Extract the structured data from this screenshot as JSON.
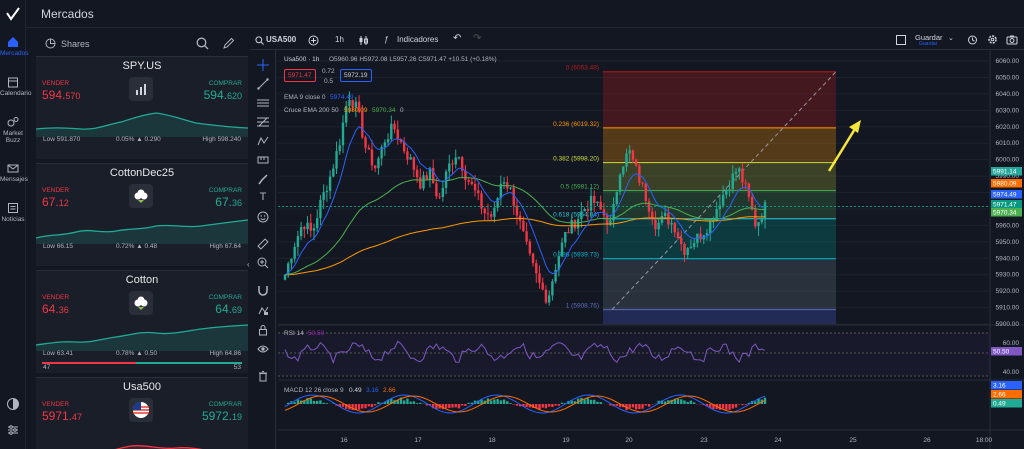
{
  "app": {
    "title": "Mercados"
  },
  "nav": [
    {
      "label": "Mercados",
      "icon": "home-icon",
      "active": true
    },
    {
      "label": "Calendario",
      "icon": "calendar-icon"
    },
    {
      "label": "Market Buzz",
      "icon": "buzz-icon"
    },
    {
      "label": "Mensajes",
      "icon": "mail-icon"
    },
    {
      "label": "Noticias",
      "icon": "news-icon"
    }
  ],
  "watchlist": {
    "title": "Shares",
    "items": [
      {
        "name": "SPY.US",
        "sell_label": "VENDER",
        "buy_label": "COMPRAR",
        "sell_main": "594.",
        "sell_small": "570",
        "buy_main": "594.",
        "buy_small": "620",
        "low": "Low 591.870",
        "change": "0.05% ▲ 0.290",
        "high": "High 598.240",
        "trend": "up",
        "logo": "chart-logo-icon"
      },
      {
        "name": "CottonDec25",
        "sell_label": "VENDER",
        "buy_label": "COMPRAR",
        "sell_main": "67.",
        "sell_small": "12",
        "buy_main": "67.",
        "buy_small": "36",
        "low": "Low 66.15",
        "change": "0.72% ▲ 0.48",
        "high": "High 67.64",
        "trend": "up",
        "logo": "cotton-icon"
      },
      {
        "name": "Cotton",
        "sell_label": "VENDER",
        "buy_label": "COMPRAR",
        "sell_main": "64.",
        "sell_small": "36",
        "buy_main": "64.",
        "buy_small": "69",
        "low": "Low 63.41",
        "change": "0.78% ▲ 0.50",
        "high": "High 64.86",
        "bar_left": "47",
        "bar_right": "53",
        "trend": "up",
        "logo": "cotton-icon"
      },
      {
        "name": "Usa500",
        "sell_label": "VENDER",
        "buy_label": "COMPRAR",
        "sell_main": "5971.",
        "sell_small": "47",
        "buy_main": "5972.",
        "buy_small": "19",
        "trend": "down",
        "logo": "us-flag-icon"
      }
    ]
  },
  "toolbar": {
    "symbol": "USA500",
    "interval": "1h",
    "indicators": "Indicadores",
    "save": "Guardar",
    "save_sub": "Guardar"
  },
  "legend": {
    "symbol": "Usa500 · 1h",
    "ohlc": "O5960.96  H5972.08  L5957.26  C5971.47  +10.51 (+0.18%)",
    "sell_box": "5971.47",
    "mid_top": "0.72",
    "mid_bot": "0.5",
    "buy_box": "5972.19",
    "ema": "EMA  9 close 0",
    "ema_val": "5974.49",
    "cross": "Cruce EMA  200 50",
    "cross_v1": "5980.09",
    "cross_v2": "5970.34",
    "cross_v3": "0"
  },
  "fib": [
    {
      "ratio": "0 (6053.48)",
      "price": 6053.48,
      "color": "#b71c1c"
    },
    {
      "ratio": "0.236 (6019.32)",
      "price": 6019.32,
      "color": "#ff9800"
    },
    {
      "ratio": "0.382 (5998.20)",
      "price": 5998.2,
      "color": "#cddc39"
    },
    {
      "ratio": "0.5 (5981.12)",
      "price": 5981.12,
      "color": "#4caf50"
    },
    {
      "ratio": "0.618 (5964.04)",
      "price": 5964.04,
      "color": "#26c6da"
    },
    {
      "ratio": "0.786 (5939.73)",
      "price": 5939.73,
      "color": "#00bcd4"
    },
    {
      "ratio": "1 (5908.76)",
      "price": 5908.76,
      "color": "#5c6bc0"
    }
  ],
  "price_axis": [
    "6060.00",
    "6050.00",
    "6040.00",
    "6030.00",
    "6020.00",
    "6010.00",
    "6000.00",
    "5990.00",
    "5980.00",
    "5970.00",
    "5960.00",
    "5950.00",
    "5940.00",
    "5930.00",
    "5920.00",
    "5910.00",
    "5900.00"
  ],
  "price_tags": [
    {
      "text": "5991.14",
      "color": "#26a69a"
    },
    {
      "text": "5980.09",
      "color": "#ff6d00"
    },
    {
      "text": "5974.49",
      "color": "#2962ff"
    },
    {
      "text": "5971.47",
      "color": "#089981"
    },
    {
      "text": "5970.34",
      "color": "#4caf50"
    }
  ],
  "rsi": {
    "label": "RSI  14",
    "value": "50.50",
    "axis": [
      "60.00",
      "50.50",
      "40.00"
    ]
  },
  "macd": {
    "label": "MACD  12 26 close 9",
    "v1": "0.49",
    "v2": "3.16",
    "v3": "2.66",
    "tags": [
      "3.16",
      "2.66",
      "0.49"
    ]
  },
  "time_axis": [
    "16",
    "17",
    "18",
    "19",
    "20",
    "23",
    "24",
    "25",
    "26",
    "18:00"
  ],
  "colors": {
    "up": "#22ab94",
    "down": "#f23645",
    "accent": "#2962ff"
  }
}
